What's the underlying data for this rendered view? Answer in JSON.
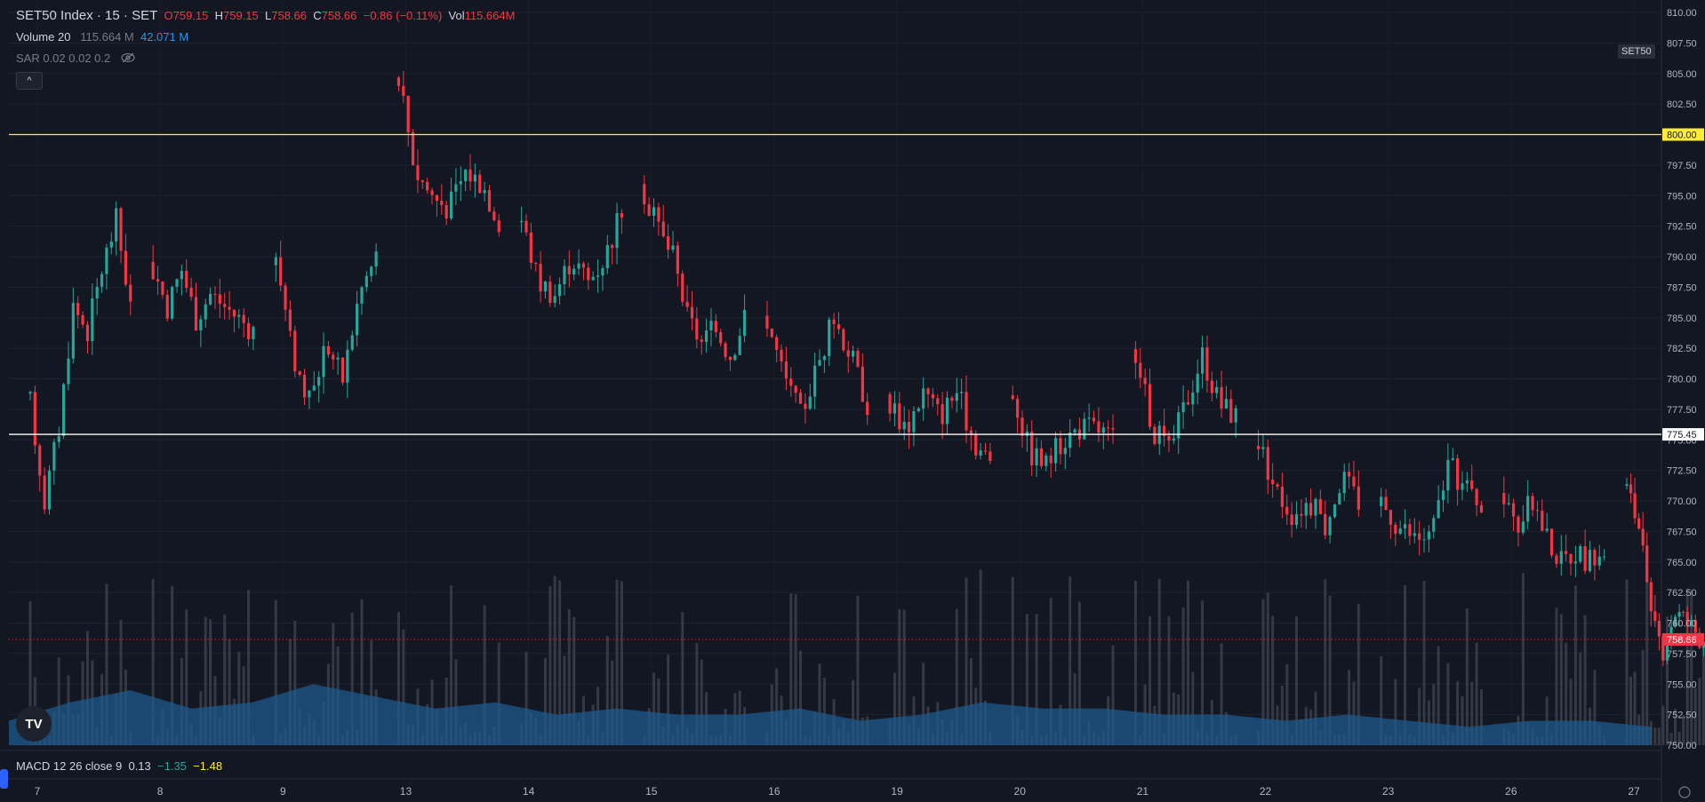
{
  "legend": {
    "symbol": "SET50 Index · 15 · SET",
    "o_label": "O",
    "o_value": "759.15",
    "h_label": "H",
    "h_value": "759.15",
    "l_label": "L",
    "l_value": "758.66",
    "c_label": "C",
    "c_value": "758.66",
    "change": "−0.86 (−0.11%)",
    "vol_label": "Vol",
    "vol_value": "115.664M",
    "volume_name": "Volume 20",
    "volume_value": "115.664 M",
    "volume_ma": "42.071 M",
    "sar": "SAR 0.02 0.02 0.2",
    "macd_name": "MACD 12 26 close 9",
    "macd_v1": "0.13",
    "macd_v2": "−1.35",
    "macd_v3": "−1.48"
  },
  "symbol_tag": "SET50",
  "collapse_icon": "^",
  "logo_text": "TV",
  "colors": {
    "up": "#26a69a",
    "down": "#f23645",
    "background": "#131722",
    "volume_ma": "#1e5a8c",
    "line_800": "#ffeb3b",
    "line_775": "#ffffff"
  },
  "chart_data": {
    "type": "candlestick",
    "ylim": [
      750,
      810
    ],
    "y_ticks": [
      "810.00",
      "807.50",
      "805.00",
      "802.50",
      "800.00",
      "797.50",
      "795.00",
      "792.50",
      "790.00",
      "787.50",
      "785.00",
      "782.50",
      "780.00",
      "777.50",
      "775.00",
      "772.50",
      "770.00",
      "767.50",
      "765.00",
      "762.50",
      "760.00",
      "757.50",
      "755.00",
      "752.50",
      "750.00"
    ],
    "x_ticks": [
      "7",
      "8",
      "9",
      "13",
      "14",
      "15",
      "16",
      "19",
      "20",
      "21",
      "22",
      "23",
      "26",
      "27"
    ],
    "horizontal_lines": [
      {
        "value": 800.0,
        "label": "800.00",
        "color": "#ffeb3b"
      },
      {
        "value": 775.45,
        "label": "775.45",
        "color": "#ffffff"
      }
    ],
    "last_price": {
      "value": 758.66,
      "label": "758.66"
    },
    "day_paths": [
      [
        778,
        770,
        776,
        786,
        784,
        789,
        793,
        786
      ],
      [
        789,
        786,
        789,
        785,
        787,
        786,
        785,
        784
      ],
      [
        790,
        782,
        778,
        783,
        780,
        787,
        790
      ],
      [
        805,
        797,
        795,
        794,
        797,
        796,
        793
      ],
      [
        793,
        788,
        787,
        790,
        788,
        790,
        794
      ],
      [
        795,
        792,
        790,
        785,
        783,
        784,
        782,
        785
      ],
      [
        785,
        780,
        777,
        781,
        785,
        782,
        778
      ],
      [
        778,
        776,
        779,
        777,
        779,
        775,
        773
      ],
      [
        779,
        774,
        773,
        775,
        776,
        776,
        775
      ],
      [
        782,
        776,
        774,
        778,
        782,
        778,
        777
      ],
      [
        775,
        771,
        769,
        770,
        768,
        772,
        770
      ],
      [
        770,
        768,
        767,
        767,
        773,
        771,
        770
      ],
      [
        770,
        768,
        770,
        767,
        765,
        766,
        765,
        766
      ],
      [
        771,
        768,
        760,
        758,
        761,
        760,
        759,
        758.66
      ]
    ],
    "volume_ma_profile": [
      752,
      753.5,
      754.5,
      753,
      753.5,
      755,
      754,
      753,
      753.5,
      752.5,
      753,
      752.5,
      752.5,
      753,
      752,
      752.5,
      753.5,
      753,
      753,
      752.5,
      752.5,
      752,
      752.5,
      752,
      751.5,
      752,
      752,
      751.5
    ]
  }
}
